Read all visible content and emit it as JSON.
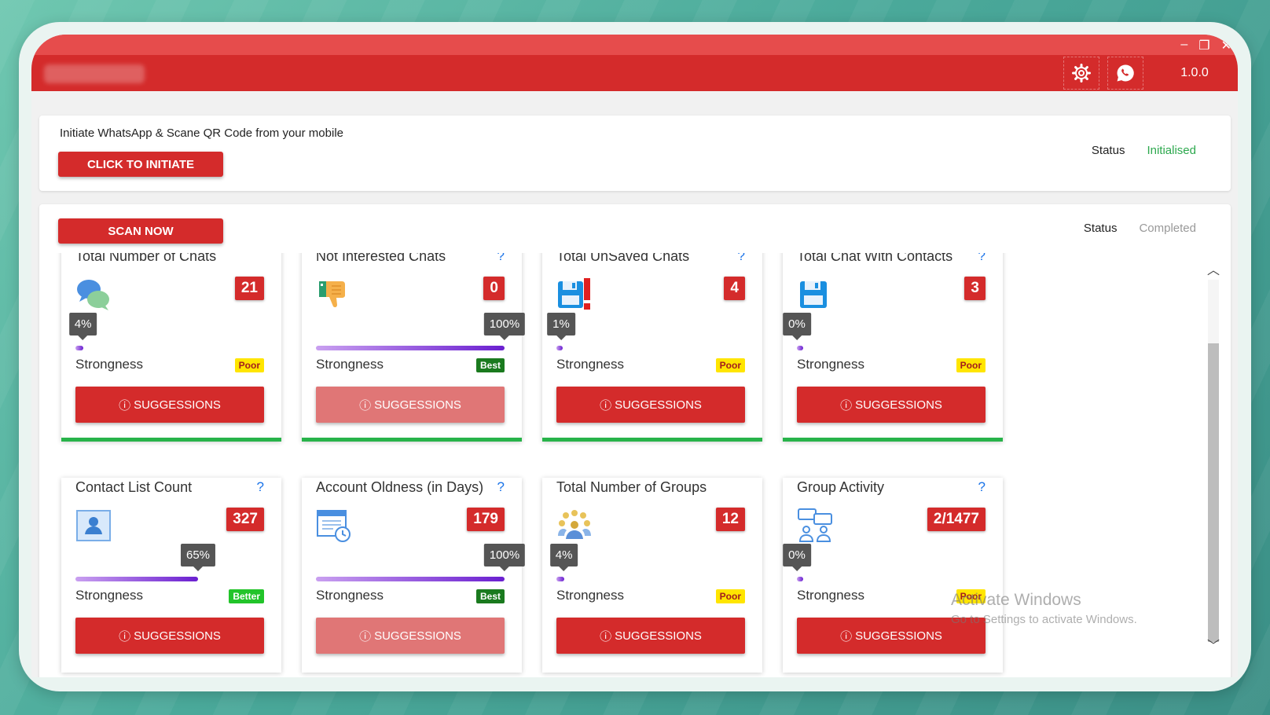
{
  "app": {
    "version": "1.0.0",
    "window_controls": [
      "–",
      "❐",
      "✕"
    ]
  },
  "init_panel": {
    "instruction": "Initiate WhatsApp & Scane QR Code from your mobile",
    "button": "CLICK TO INITIATE",
    "status_label": "Status",
    "status_value": "Initialised"
  },
  "scan_panel": {
    "button": "SCAN NOW",
    "status_label": "Status",
    "status_value": "Completed"
  },
  "cards": [
    {
      "title": "Total Number of Chats",
      "help": "",
      "icon": "chat-bubbles-icon",
      "count": "21",
      "percent": "4%",
      "strength": 4,
      "strength_label": "Strongness",
      "rating": "Poor",
      "button": "SUGGESSIONS",
      "disabled": false
    },
    {
      "title": "Not Interested Chats",
      "help": "?",
      "icon": "thumbs-down-icon",
      "count": "0",
      "percent": "100%",
      "strength": 100,
      "strength_label": "Strongness",
      "rating": "Best",
      "button": "SUGGESSIONS",
      "disabled": true
    },
    {
      "title": "Total UnSaved Chats",
      "help": "?",
      "icon": "floppy-alert-icon",
      "count": "4",
      "percent": "1%",
      "strength": 1,
      "strength_label": "Strongness",
      "rating": "Poor",
      "button": "SUGGESSIONS",
      "disabled": false
    },
    {
      "title": "Total Chat With Contacts",
      "help": "?",
      "icon": "floppy-disk-icon",
      "count": "3",
      "percent": "0%",
      "strength": 0,
      "strength_label": "Strongness",
      "rating": "Poor",
      "button": "SUGGESSIONS",
      "disabled": false
    },
    {
      "title": "Contact List Count",
      "help": "?",
      "icon": "contact-card-icon",
      "count": "327",
      "percent": "65%",
      "strength": 65,
      "strength_label": "Strongness",
      "rating": "Better",
      "button": "SUGGESSIONS",
      "disabled": false
    },
    {
      "title": "Account Oldness (in Days)",
      "help": "?",
      "icon": "calendar-clock-icon",
      "count": "179",
      "percent": "100%",
      "strength": 100,
      "strength_label": "Strongness",
      "rating": "Best",
      "button": "SUGGESSIONS",
      "disabled": true
    },
    {
      "title": "Total Number of Groups",
      "help": "",
      "icon": "people-group-icon",
      "count": "12",
      "percent": "4%",
      "strength": 4,
      "strength_label": "Strongness",
      "rating": "Poor",
      "button": "SUGGESSIONS",
      "disabled": false
    },
    {
      "title": "Group Activity",
      "help": "?",
      "icon": "group-chat-icon",
      "count": "2/1477",
      "percent": "0%",
      "strength": 0,
      "strength_label": "Strongness",
      "rating": "Poor",
      "button": "SUGGESSIONS",
      "disabled": false
    }
  ],
  "watermark": {
    "line1": "Activate Windows",
    "line2": "Go to Settings to activate Windows."
  },
  "colors": {
    "brand_red": "#d42b2b",
    "success_green": "#28b34a",
    "status_green": "#2ca84d"
  }
}
